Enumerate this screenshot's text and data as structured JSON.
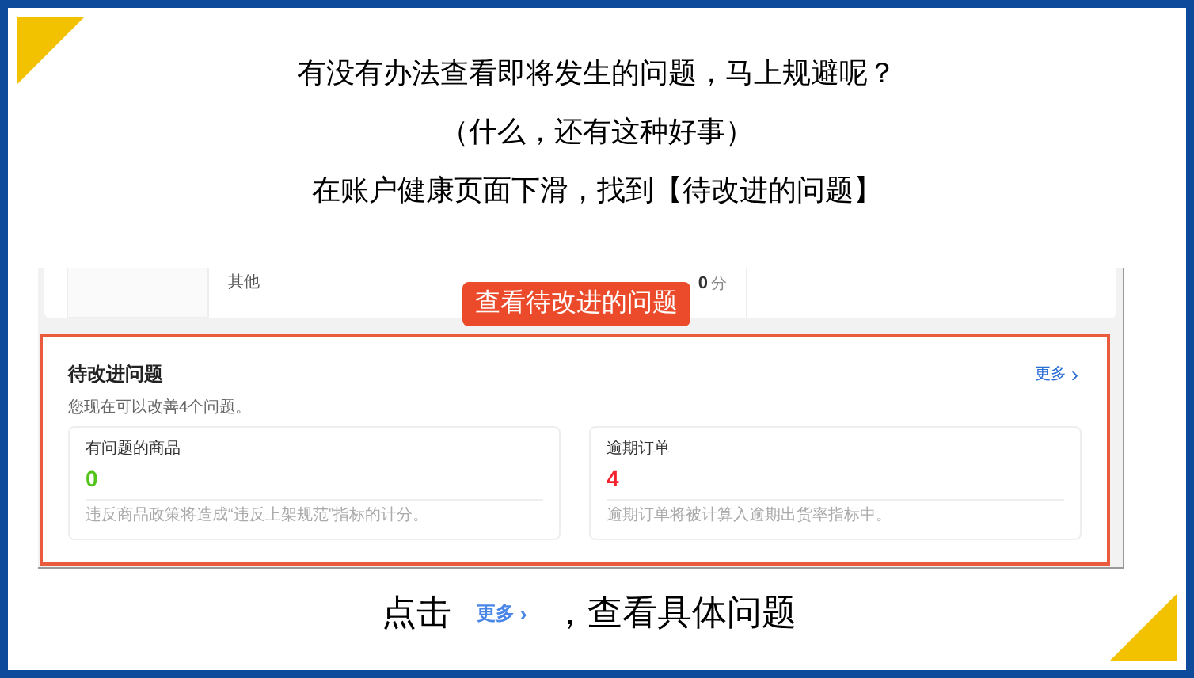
{
  "heading_lines": [
    "有没有办法查看即将发生的问题，马上规避呢？",
    "（什么，还有这种好事）",
    "在账户健康页面下滑，找到【待改进的问题】"
  ],
  "screenshot": {
    "top_card": {
      "label": "其他",
      "score": "0",
      "unit": "分"
    },
    "callout": "查看待改进的问题",
    "section": {
      "title": "待改进问题",
      "more": "更多",
      "more_icon": "›",
      "subtitle": "您现在可以改善4个问题。",
      "cards": [
        {
          "label": "有问题的商品",
          "value": "0",
          "color": "#52c41a",
          "note": "违反商品政策将造成“违反上架规范”指标的计分。"
        },
        {
          "label": "逾期订单",
          "value": "4",
          "color": "#f5222d",
          "note": "逾期订单将被计算入逾期出货率指标中。"
        }
      ]
    }
  },
  "caption": {
    "before": "点击",
    "link": "更多",
    "link_icon": "›",
    "after": "，查看具体问题"
  }
}
